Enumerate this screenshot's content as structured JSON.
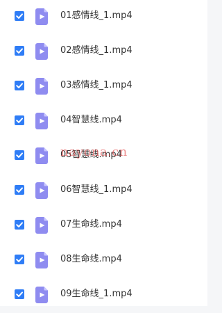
{
  "files": [
    {
      "name": "01感情线_1.mp4",
      "checked": true
    },
    {
      "name": "02感情线_1.mp4",
      "checked": true
    },
    {
      "name": "03感情线_1.mp4",
      "checked": true
    },
    {
      "name": "04智慧线.mp4",
      "checked": true
    },
    {
      "name": "05智慧线.mp4",
      "checked": true
    },
    {
      "name": "06智慧线_1.mp4",
      "checked": true
    },
    {
      "name": "07生命线.mp4",
      "checked": true
    },
    {
      "name": "08生命线.mp4",
      "checked": true
    },
    {
      "name": "09生命线_1.mp4",
      "checked": true
    }
  ],
  "watermark": "nayona.cn",
  "colors": {
    "checkbox": "#2f7df6",
    "icon": "#8f8cf0",
    "text": "#333333",
    "watermark": "#e04646"
  }
}
